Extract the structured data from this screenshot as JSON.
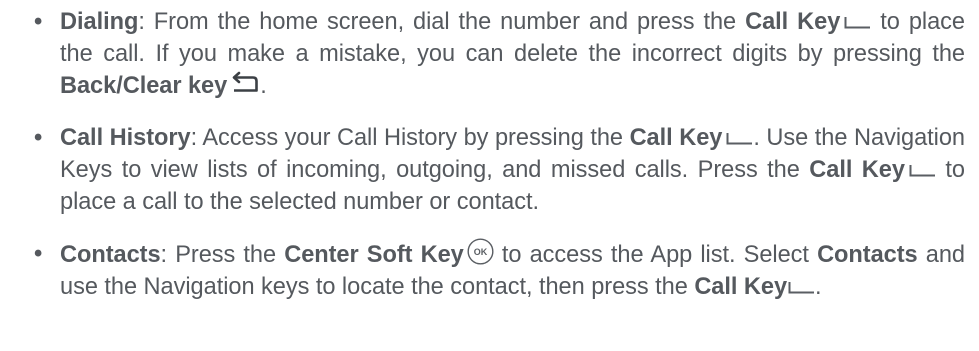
{
  "bullet_char": "•",
  "items": [
    {
      "term": "Dialing",
      "t1": ": From the home screen, dial the number and press the ",
      "k1": "Call Key",
      "t2": " to place the call. If you make a mistake, you can delete the incorrect digits by pressing the ",
      "k2": "Back/Clear key",
      "t3": "."
    },
    {
      "term": "Call History",
      "t1": ": Access your Call History by pressing the ",
      "k1": "Call Key",
      "t2": ". Use the Navigation Keys to view lists of incoming, outgoing, and missed calls. Press the ",
      "k2": "Call Key",
      "t3": " to place a call to the selected number or contact."
    },
    {
      "term": "Contacts",
      "t1": ": Press the ",
      "k1": "Center Soft Key",
      "t2": " to access the App list. Select ",
      "k2": "Contacts",
      "t3": " and use the Navigation keys to locate the contact, then press the ",
      "k3": "Call Key",
      "t4": "."
    }
  ],
  "icons": {
    "call_key": "call-key-icon",
    "back_clear_key": "back-clear-key-icon",
    "center_soft_key": "ok-key-icon",
    "ok_label": "OK"
  },
  "colors": {
    "text": "#55595e",
    "icon_stroke": "#5a5e63"
  }
}
